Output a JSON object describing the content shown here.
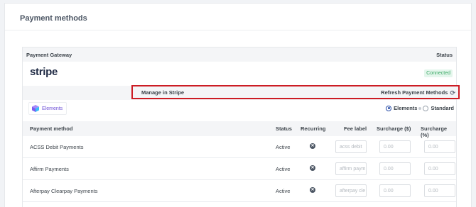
{
  "page": {
    "title": "Payment methods"
  },
  "gateway": {
    "header_left": "Payment Gateway",
    "header_right": "Status",
    "logo_text": "stripe",
    "status": "Connected",
    "manage_label": "Manage in Stripe",
    "refresh_label": "Refresh Payment Methods"
  },
  "mode": {
    "chip_label": "Elements",
    "options": [
      "Elements",
      "Standard"
    ],
    "selected": "Elements"
  },
  "table": {
    "columns": [
      "Payment method",
      "Status",
      "Recurring",
      "Fee label",
      "Surcharge ($)",
      "Surcharge (%)"
    ],
    "rows": [
      {
        "name": "ACSS Debit Payments",
        "status": "Active",
        "fee_placeholder": "acss debit",
        "surcharge_fixed": "0.00",
        "surcharge_percent": "0.00"
      },
      {
        "name": "Affirm Payments",
        "status": "Active",
        "fee_placeholder": "affirm paym",
        "surcharge_fixed": "0.00",
        "surcharge_percent": "0.00"
      },
      {
        "name": "Afterpay Clearpay Payments",
        "status": "Active",
        "fee_placeholder": "afterpay cle",
        "surcharge_fixed": "0.00",
        "surcharge_percent": "0.00"
      }
    ]
  },
  "colors": {
    "highlight": "#cc1c24",
    "connected": "#3aa864",
    "elements_accent": "#6d4fd6"
  }
}
